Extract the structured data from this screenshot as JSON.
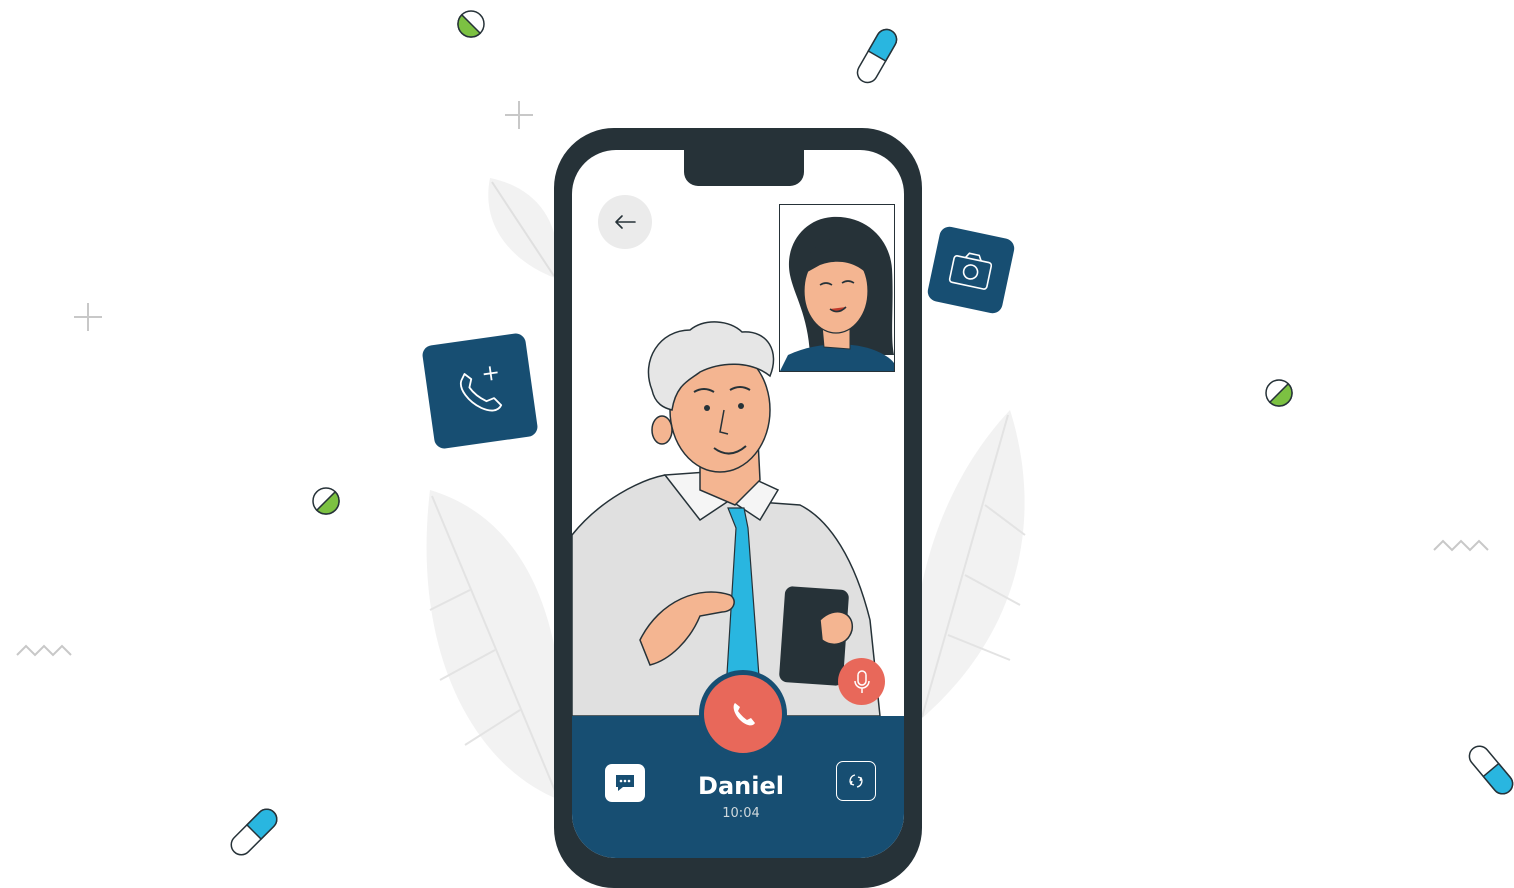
{
  "call": {
    "caller_name": "Daniel",
    "duration": "10:04"
  },
  "icons": {
    "back": "arrow-left-icon",
    "end_call": "phone-hangup-icon",
    "mic": "microphone-icon",
    "chat": "chat-bubble-icon",
    "switch_camera": "switch-camera-icon",
    "add_call_tile": "phone-add-icon",
    "camera_tile": "camera-icon"
  },
  "colors": {
    "phone_body": "#263238",
    "bottom_bar": "#174e72",
    "end_call": "#e8685a",
    "tie": "#29b6e0",
    "pill_green": "#7cc142",
    "capsule_blue": "#29b6e0"
  }
}
